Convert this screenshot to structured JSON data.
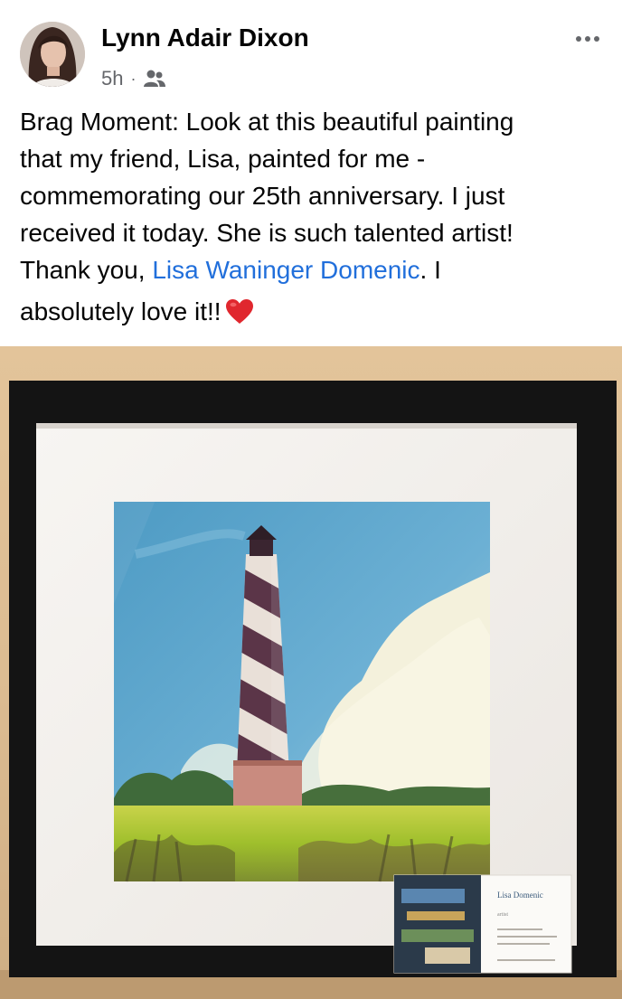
{
  "post": {
    "author": "Lynn Adair Dixon",
    "time": "5h",
    "separator": "·",
    "audience_icon": "friends-icon",
    "menu_icon": "more-options-icon",
    "text_lines": [
      "Brag Moment: Look at this beautiful painting",
      "that my friend, Lisa, painted for me -",
      "commemorating our 25th anniversary.  I just",
      "received it today.  She is such talented artist!"
    ],
    "line5_before": "Thank you, ",
    "mention": "Lisa Waninger Domenic",
    "line5_after": ".  I",
    "line6": "absolutely love it!!",
    "emoji": "red-heart-icon"
  },
  "photo": {
    "card_name": "Lisa Domenic",
    "card_title": "artist"
  },
  "colors": {
    "text": "#050505",
    "secondary": "#65676b",
    "link": "#216fdb",
    "heart": "#e0272e"
  }
}
